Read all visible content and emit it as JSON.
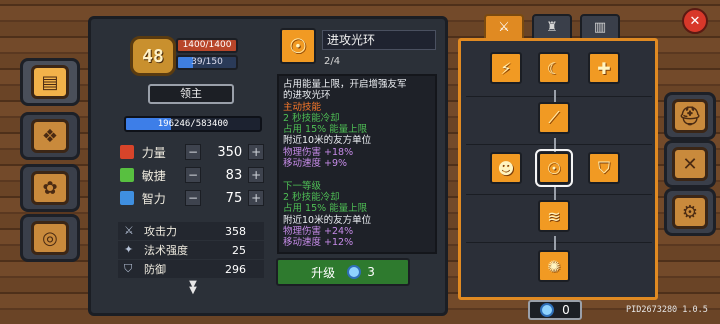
{
  "hero": {
    "level": "48",
    "hp_text": "1400/1400",
    "mp_text": "39/150",
    "mp_fraction": 0.26,
    "rank_label": "领主",
    "xp_text": "196246/583400",
    "xp_fraction": 0.336
  },
  "stats": [
    {
      "name": "力量",
      "value": "350",
      "icon": "strength-fist-icon",
      "color": "#d7442a"
    },
    {
      "name": "敏捷",
      "value": "83",
      "icon": "agility-leaf-icon",
      "color": "#58c040"
    },
    {
      "name": "智力",
      "value": "75",
      "icon": "intellect-book-icon",
      "color": "#3f8fe0"
    }
  ],
  "derived": [
    {
      "name": "攻击力",
      "value": "358",
      "icon": "sword-icon"
    },
    {
      "name": "法术强度",
      "value": "25",
      "icon": "wand-icon"
    },
    {
      "name": "防御",
      "value": "296",
      "icon": "shield-icon"
    }
  ],
  "skill": {
    "title": "进攻光环",
    "level": "2/4",
    "desc_lines": [
      {
        "text": "占用能量上限，开启增强友军",
        "color": "w"
      },
      {
        "text": "的进攻光环",
        "color": "w"
      },
      {
        "text": "主动技能",
        "color": "o"
      },
      {
        "text": "2 秒技能冷却",
        "color": "g"
      },
      {
        "text": "占用 15% 能量上限",
        "color": "g"
      },
      {
        "text": "附近10米的友方单位",
        "color": "w"
      },
      {
        "text": "物理伤害 +18%",
        "color": "p"
      },
      {
        "text": "移动速度 +9%",
        "color": "p"
      },
      {
        "text": "",
        "color": "w"
      },
      {
        "text": "下一等级",
        "color": "g"
      },
      {
        "text": "2 秒技能冷却",
        "color": "g"
      },
      {
        "text": "占用 15% 能量上限",
        "color": "g"
      },
      {
        "text": "附近10米的友方单位",
        "color": "w"
      },
      {
        "text": "物理伤害 +24%",
        "color": "p"
      },
      {
        "text": "移动速度 +12%",
        "color": "p"
      }
    ],
    "upgrade_label": "升级",
    "upgrade_cost": "3"
  },
  "tree": {
    "tabs": [
      "sword-tab-icon",
      "tower-tab-icon",
      "castle-tab-icon"
    ],
    "points": "0"
  },
  "left_tabs": [
    "book-icon",
    "map-scroll-icon",
    "pawprint-icon",
    "wheel-icon"
  ],
  "right_tabs": [
    "helmet-icon",
    "crossed-tools-icon",
    "gear-icon"
  ],
  "footer": {
    "pid": "PID2673280 1.0.5"
  }
}
